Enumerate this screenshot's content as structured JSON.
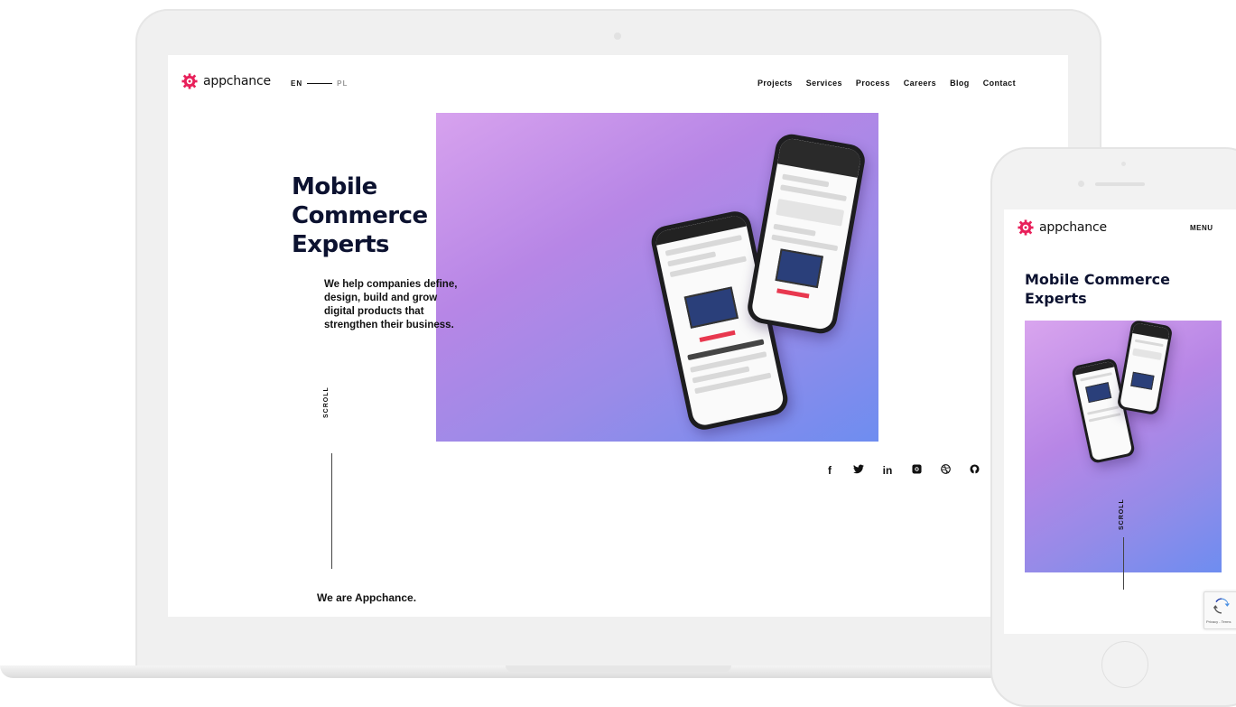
{
  "desktop": {
    "brand": "appchance",
    "lang": {
      "active": "EN",
      "inactive": "PL"
    },
    "nav": [
      "Projects",
      "Services",
      "Process",
      "Careers",
      "Blog",
      "Contact"
    ],
    "hero": {
      "title_lines": [
        "Mobile",
        "Commerce",
        "Experts"
      ],
      "subtitle_lines": [
        "We help companies define,",
        "design, build and grow",
        "digital products that",
        "strengthen their business."
      ]
    },
    "scroll_label": "SCROLL",
    "social": [
      "f",
      "🐦",
      "in",
      "▣",
      "◎",
      "◐"
    ],
    "about_heading": "We are Appchance."
  },
  "mobile": {
    "brand": "appchance",
    "menu_label": "MENU",
    "title_lines": [
      "Mobile Commerce",
      "Experts"
    ],
    "scroll_label": "SCROLL"
  },
  "recaptcha": {
    "text": "Privacy - Terms"
  },
  "colors": {
    "brand_red": "#e8205a",
    "headline_navy": "#0c1230",
    "gradient_start": "#d7a2ee",
    "gradient_end": "#6e8df0"
  },
  "icons": {
    "social": [
      "facebook-icon",
      "twitter-icon",
      "linkedin-icon",
      "instagram-icon",
      "dribbble-icon",
      "github-icon"
    ]
  }
}
